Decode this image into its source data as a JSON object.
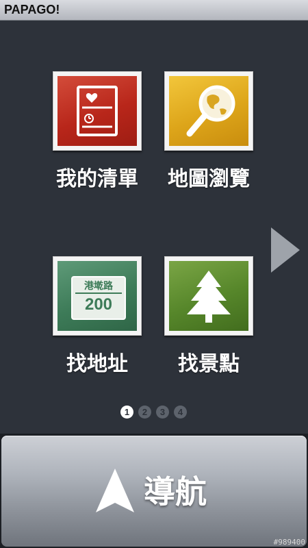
{
  "app": {
    "title": "PAPAGO!"
  },
  "menu": {
    "tiles": [
      {
        "label": "我的清單",
        "icon": "list-document-icon"
      },
      {
        "label": "地圖瀏覽",
        "icon": "globe-magnifier-icon"
      },
      {
        "label": "找地址",
        "icon": "address-sign-icon",
        "sign_text": "港墘路",
        "sign_number": "200"
      },
      {
        "label": "找景點",
        "icon": "tree-icon"
      }
    ],
    "next_icon": "chevron-right-icon"
  },
  "pager": {
    "pages": [
      "1",
      "2",
      "3",
      "4"
    ],
    "active": 1
  },
  "nav": {
    "label": "導航",
    "icon": "navigation-arrow-icon"
  },
  "watermark": "#989400",
  "colors": {
    "background": "#2d323a",
    "tile_red": "#b8261a",
    "tile_yellow": "#dda51a",
    "tile_teal": "#3d7b58",
    "tile_green": "#56862a"
  }
}
